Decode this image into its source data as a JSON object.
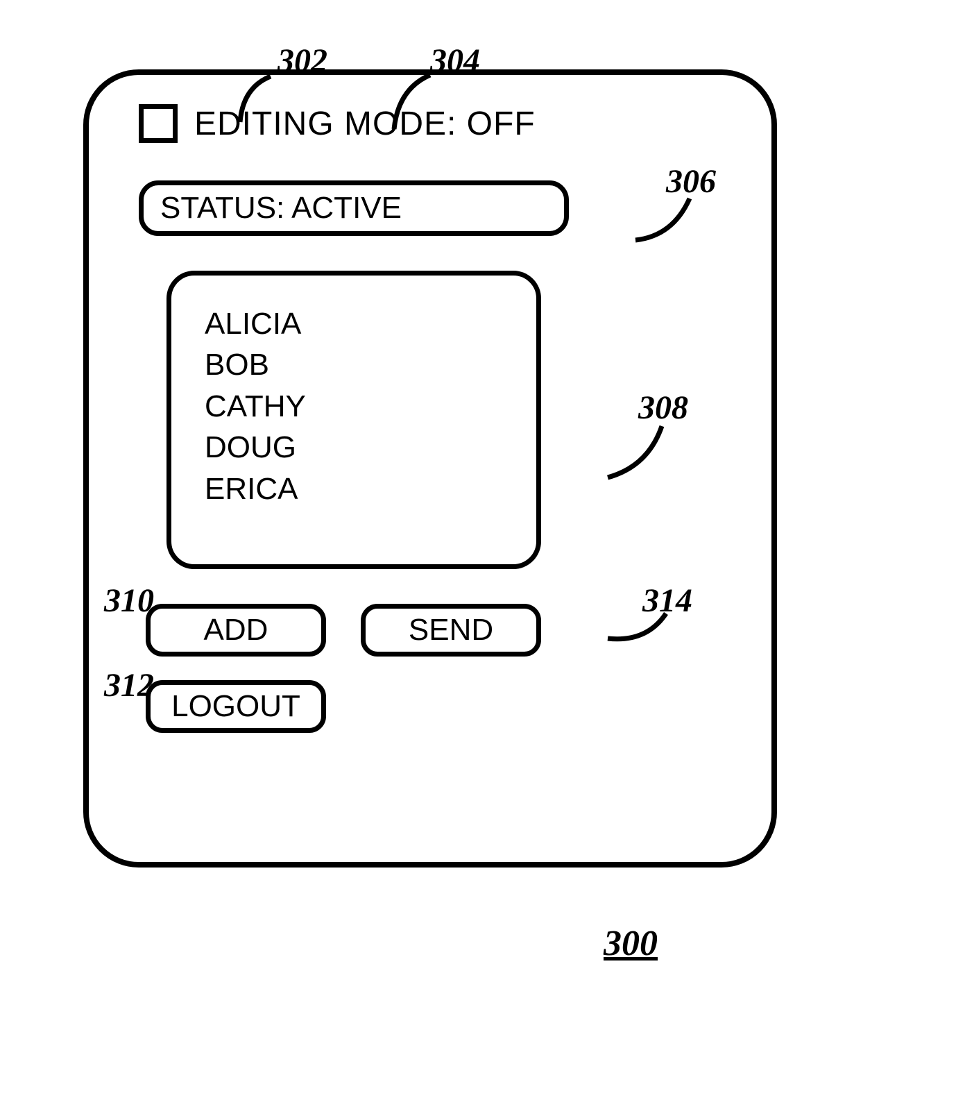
{
  "callouts": {
    "c302": "302",
    "c304": "304",
    "c306": "306",
    "c308": "308",
    "c310": "310",
    "c312": "312",
    "c314": "314"
  },
  "editing_mode": {
    "label": "EDITING MODE: OFF"
  },
  "status": {
    "text": "STATUS: ACTIVE"
  },
  "contacts": [
    "ALICIA",
    "BOB",
    "CATHY",
    "DOUG",
    "ERICA"
  ],
  "buttons": {
    "add": "ADD",
    "send": "SEND",
    "logout": "LOGOUT"
  },
  "figure_label": "300"
}
